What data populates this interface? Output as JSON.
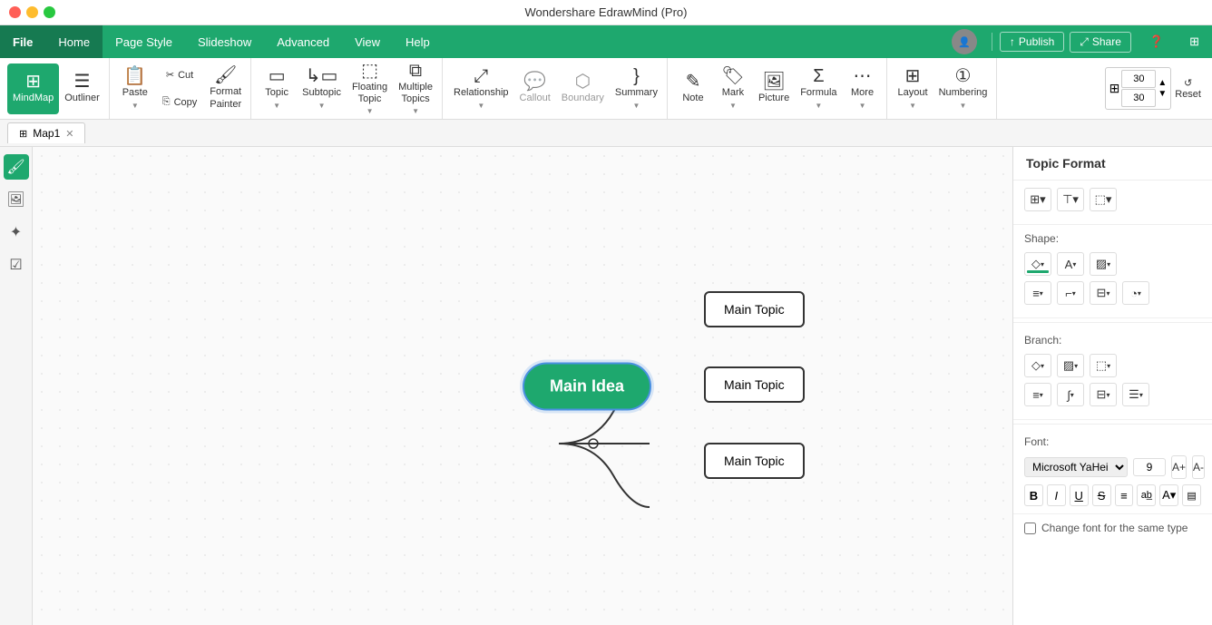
{
  "app": {
    "title": "Wondershare EdrawMind (Pro)",
    "traffic_lights": [
      "red",
      "yellow",
      "green"
    ]
  },
  "menu": {
    "items": [
      {
        "label": "File",
        "active": false,
        "is_file": true
      },
      {
        "label": "Home",
        "active": true
      },
      {
        "label": "Page Style",
        "active": false
      },
      {
        "label": "Slideshow",
        "active": false
      },
      {
        "label": "Advanced",
        "active": false
      },
      {
        "label": "View",
        "active": false
      },
      {
        "label": "Help",
        "active": false
      }
    ],
    "publish_label": "Publish",
    "share_label": "Share"
  },
  "toolbar": {
    "groups": [
      {
        "buttons": [
          {
            "id": "mindmap",
            "icon": "⊞",
            "label": "MindMap",
            "active": true,
            "has_arrow": false
          },
          {
            "id": "outliner",
            "icon": "☰",
            "label": "Outliner",
            "active": false,
            "has_arrow": false
          }
        ]
      },
      {
        "buttons": [
          {
            "id": "paste",
            "icon": "📋",
            "label": "Paste",
            "active": false,
            "has_arrow": true
          },
          {
            "id": "cut",
            "icon": "✂",
            "label": "Cut",
            "active": false,
            "has_arrow": false
          },
          {
            "id": "copy",
            "icon": "⎘",
            "label": "Copy",
            "active": false,
            "has_arrow": false
          },
          {
            "id": "format-painter",
            "icon": "🖌",
            "label": "Format\nPainter",
            "active": false,
            "has_arrow": false
          }
        ]
      },
      {
        "buttons": [
          {
            "id": "topic",
            "icon": "▭",
            "label": "Topic",
            "active": false,
            "has_arrow": true
          },
          {
            "id": "subtopic",
            "icon": "↳▭",
            "label": "Subtopic",
            "active": false,
            "has_arrow": true
          },
          {
            "id": "floating-topic",
            "icon": "◌▭",
            "label": "Floating\nTopic",
            "active": false,
            "has_arrow": true
          },
          {
            "id": "multiple-topics",
            "icon": "⧉",
            "label": "Multiple\nTopics",
            "active": false,
            "has_arrow": true
          }
        ]
      },
      {
        "buttons": [
          {
            "id": "relationship",
            "icon": "⤢",
            "label": "Relationship",
            "active": false,
            "has_arrow": true
          },
          {
            "id": "callout",
            "icon": "💬",
            "label": "Callout",
            "active": false,
            "has_arrow": false,
            "disabled": true
          },
          {
            "id": "boundary",
            "icon": "⬡",
            "label": "Boundary",
            "active": false,
            "has_arrow": false,
            "disabled": true
          },
          {
            "id": "summary",
            "icon": "}",
            "label": "Summary",
            "active": false,
            "has_arrow": true
          }
        ]
      },
      {
        "buttons": [
          {
            "id": "note",
            "icon": "✎",
            "label": "Note",
            "active": false,
            "has_arrow": false
          },
          {
            "id": "mark",
            "icon": "🏷",
            "label": "Mark",
            "active": false,
            "has_arrow": true
          },
          {
            "id": "picture",
            "icon": "🖼",
            "label": "Picture",
            "active": false,
            "has_arrow": false
          },
          {
            "id": "formula",
            "icon": "Σ",
            "label": "Formula",
            "active": false,
            "has_arrow": true
          },
          {
            "id": "more",
            "icon": "⋯",
            "label": "More",
            "active": false,
            "has_arrow": true
          }
        ]
      },
      {
        "buttons": [
          {
            "id": "layout",
            "icon": "⊞",
            "label": "Layout",
            "active": false,
            "has_arrow": true
          },
          {
            "id": "numbering",
            "icon": "①",
            "label": "Numbering",
            "active": false,
            "has_arrow": true
          }
        ]
      }
    ],
    "layout_num1": "30",
    "layout_num2": "30",
    "reset_label": "Reset"
  },
  "tabs": [
    {
      "label": "Map1",
      "active": true,
      "icon": "⊞"
    }
  ],
  "right_panel": {
    "title": "Topic Format",
    "shape_section": {
      "title": "Shape:",
      "shape_rows": [
        [
          "shape-fill",
          "border-color",
          "border-style"
        ],
        [
          "line-style",
          "corner-style",
          "dash-style",
          "shadow-style"
        ]
      ]
    },
    "branch_section": {
      "title": "Branch:",
      "branch_rows": [
        [
          "branch-color",
          "branch-style1",
          "branch-style2"
        ],
        [
          "branch-curve",
          "branch-width",
          "branch-spacing1",
          "branch-spacing2"
        ]
      ]
    },
    "font_section": {
      "title": "Font:",
      "font_family": "Microsoft YaHei",
      "font_size": "9",
      "font_controls": [
        "B",
        "I",
        "U",
        "S"
      ],
      "align_controls": [
        "≡",
        "ab̲",
        "A▾",
        "▤"
      ]
    },
    "checkbox": {
      "label": "Change font for the same type",
      "checked": false
    }
  },
  "mindmap": {
    "main_idea": "Main Idea",
    "topics": [
      {
        "id": "topic1",
        "label": "Main Topic",
        "position": "top"
      },
      {
        "id": "topic2",
        "label": "Main Topic",
        "position": "middle"
      },
      {
        "id": "topic3",
        "label": "Main Topic",
        "position": "bottom"
      }
    ]
  }
}
